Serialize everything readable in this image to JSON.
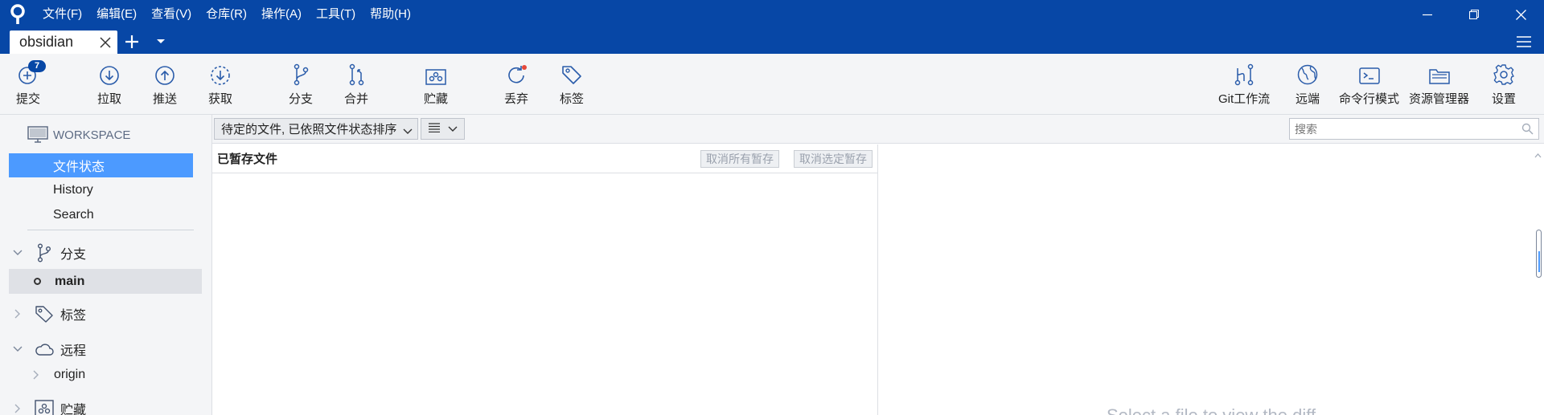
{
  "menu": [
    "文件(F)",
    "编辑(E)",
    "查看(V)",
    "仓库(R)",
    "操作(A)",
    "工具(T)",
    "帮助(H)"
  ],
  "tab": {
    "label": "obsidian"
  },
  "toolbar": {
    "commit": "提交",
    "commit_badge": "7",
    "pull": "拉取",
    "push": "推送",
    "fetch": "获取",
    "branch": "分支",
    "merge": "合并",
    "stash": "贮藏",
    "discard": "丢弃",
    "tag": "标签",
    "git_flow": "Git工作流",
    "remote": "远端",
    "terminal": "命令行模式",
    "explorer": "资源管理器",
    "settings": "设置"
  },
  "sidebar": {
    "workspace": "WORKSPACE",
    "file_status": "文件状态",
    "history": "History",
    "search": "Search",
    "branches": "分支",
    "current_branch": "main",
    "tags": "标签",
    "remotes": "远程",
    "origin": "origin",
    "stashes": "贮藏"
  },
  "filter": {
    "status_dropdown": "待定的文件, 已依照文件状态排序",
    "search_placeholder": "搜索"
  },
  "staged": {
    "title": "已暂存文件",
    "unstage_all": "取消所有暂存",
    "unstage_selected": "取消选定暂存"
  },
  "diff": {
    "hint": "Select a file to view the diff"
  },
  "colors": {
    "titlebar": "#0747a6",
    "selection": "#4c9aff",
    "panel": "#f4f5f7"
  }
}
